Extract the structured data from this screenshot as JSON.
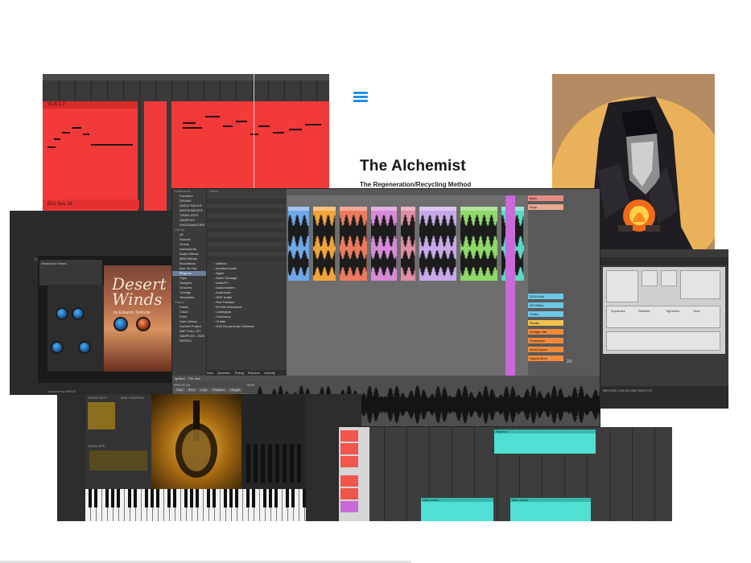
{
  "alchemist": {
    "title": "The Alchemist",
    "subtitle": "The Regeneration/Recycling Method"
  },
  "piano_roll_top": {
    "clip_label": "VLN 1 2",
    "clip2_label": "Ens Sus 16"
  },
  "browser": {
    "collections": [
      "Favorites",
      "DRUMS",
      "AUDIO RACKS",
      "INSTRUMENTS",
      "TEMPLATES",
      "SAMPLES",
      "RAGGAMATORS"
    ],
    "categories": [
      "All",
      "Sounds",
      "Drums",
      "Instruments",
      "Audio Effects",
      "MIDI Effects",
      "Modulators",
      "Max for Live",
      "Plug-Ins",
      "Clips",
      "Samples",
      "Grooves",
      "Tunings",
      "Templates"
    ],
    "places": [
      "Places",
      "Packs",
      "Cloud",
      "Push",
      "User Library",
      "Current Project",
      "DMT FULL KIT",
      "SAMPLES - 2024",
      "REPIDS"
    ],
    "filters_header": "Filters",
    "selected_category": "Plug-Ins",
    "list": [
      "Ableton",
      "Acustica Audio",
      "Apple",
      "Audio Damage",
      "AudioFX",
      "Audiomodern",
      "Audiotonix",
      "DMT Audio",
      "Red Fairlane",
      "ROOM Interactive",
      "Cableguys",
      "Celemony",
      "Cradle",
      "D16 Group Audio Software"
    ],
    "bottom_tabs": [
      "Now",
      "Quantize",
      "Timing",
      "Random",
      "Velocity"
    ]
  },
  "daw": {
    "tracks": [
      {
        "name": "Main",
        "color": "#e78a84"
      },
      {
        "name": "Keys",
        "color": "#e9a98f"
      },
      {
        "name": "2024 Kick",
        "color": "#6ec6e8"
      },
      {
        "name": "OH Rides",
        "color": "#6ec6e8"
      },
      {
        "name": "Tmbrn",
        "color": "#6ec6e8"
      },
      {
        "name": "Plucks",
        "color": "#f2c34a"
      },
      {
        "name": "Vintage Vari",
        "color": "#f58a3a"
      },
      {
        "name": "Phrasebox",
        "color": "#f58a3a"
      },
      {
        "name": "Metal Sauce",
        "color": "#f58a3a"
      },
      {
        "name": "Squeal Bum",
        "color": "#f58a3a"
      }
    ],
    "counter": "2/2",
    "bottom_header": "Ignition - The Jam",
    "bottom_buttons": [
      "Start",
      "End",
      "Loop",
      "Position",
      "Length",
      "Signature",
      "Groove",
      "Commit",
      "Warp",
      "BPM",
      "Reverse",
      "Edit"
    ],
    "bpm": "97.00",
    "global_amount": "100%"
  },
  "desert_winds": {
    "title": "Desert Winds",
    "byline": "by Eduardo Tarilonte",
    "footer": "powered by MAGIX",
    "rack_label": "Windwood Voices"
  },
  "violin": {
    "sections": [
      "SENSITIVITY",
      "MIDI CONTROL",
      "ENVELOPE"
    ]
  },
  "arranger_bottom": {
    "clip_labels": [
      "Rhythm",
      "Main Notes",
      "Main Notes"
    ]
  },
  "sampler": {
    "labels": [
      "Dynamics",
      "Release",
      "Tightness",
      "Tone"
    ],
    "bottom": "RECORD LIVE IN ONE SHOT KIT"
  },
  "colors": {
    "red_clip": "#f23a3a",
    "cyan_clip": "#4fe0d3",
    "alchemist_logo": "#1e90e0"
  }
}
